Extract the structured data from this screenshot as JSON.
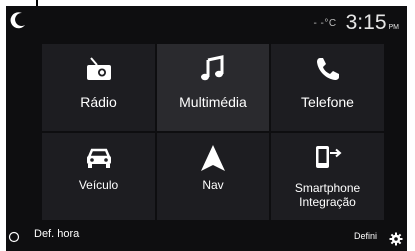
{
  "status": {
    "temperature": "- -°C",
    "time": "3:15",
    "ampm": "PM"
  },
  "tiles": [
    {
      "label": "Rádio",
      "icon": "radio-icon"
    },
    {
      "label": "Multimédia",
      "icon": "music-note-icon"
    },
    {
      "label": "Telefone",
      "icon": "phone-icon"
    },
    {
      "label": "Veículo",
      "icon": "car-icon"
    },
    {
      "label": "Nav",
      "icon": "navigation-arrow-icon"
    },
    {
      "label": "Smartphone\nIntegração",
      "icon": "smartphone-projection-icon"
    }
  ],
  "footer": {
    "time_setting_label": "Def. hora",
    "settings_label": "Defini"
  },
  "colors": {
    "background": "#0e0e10",
    "tile": "#1d1d21",
    "tile_active": "#2a2a2e",
    "text": "#ffffff"
  }
}
